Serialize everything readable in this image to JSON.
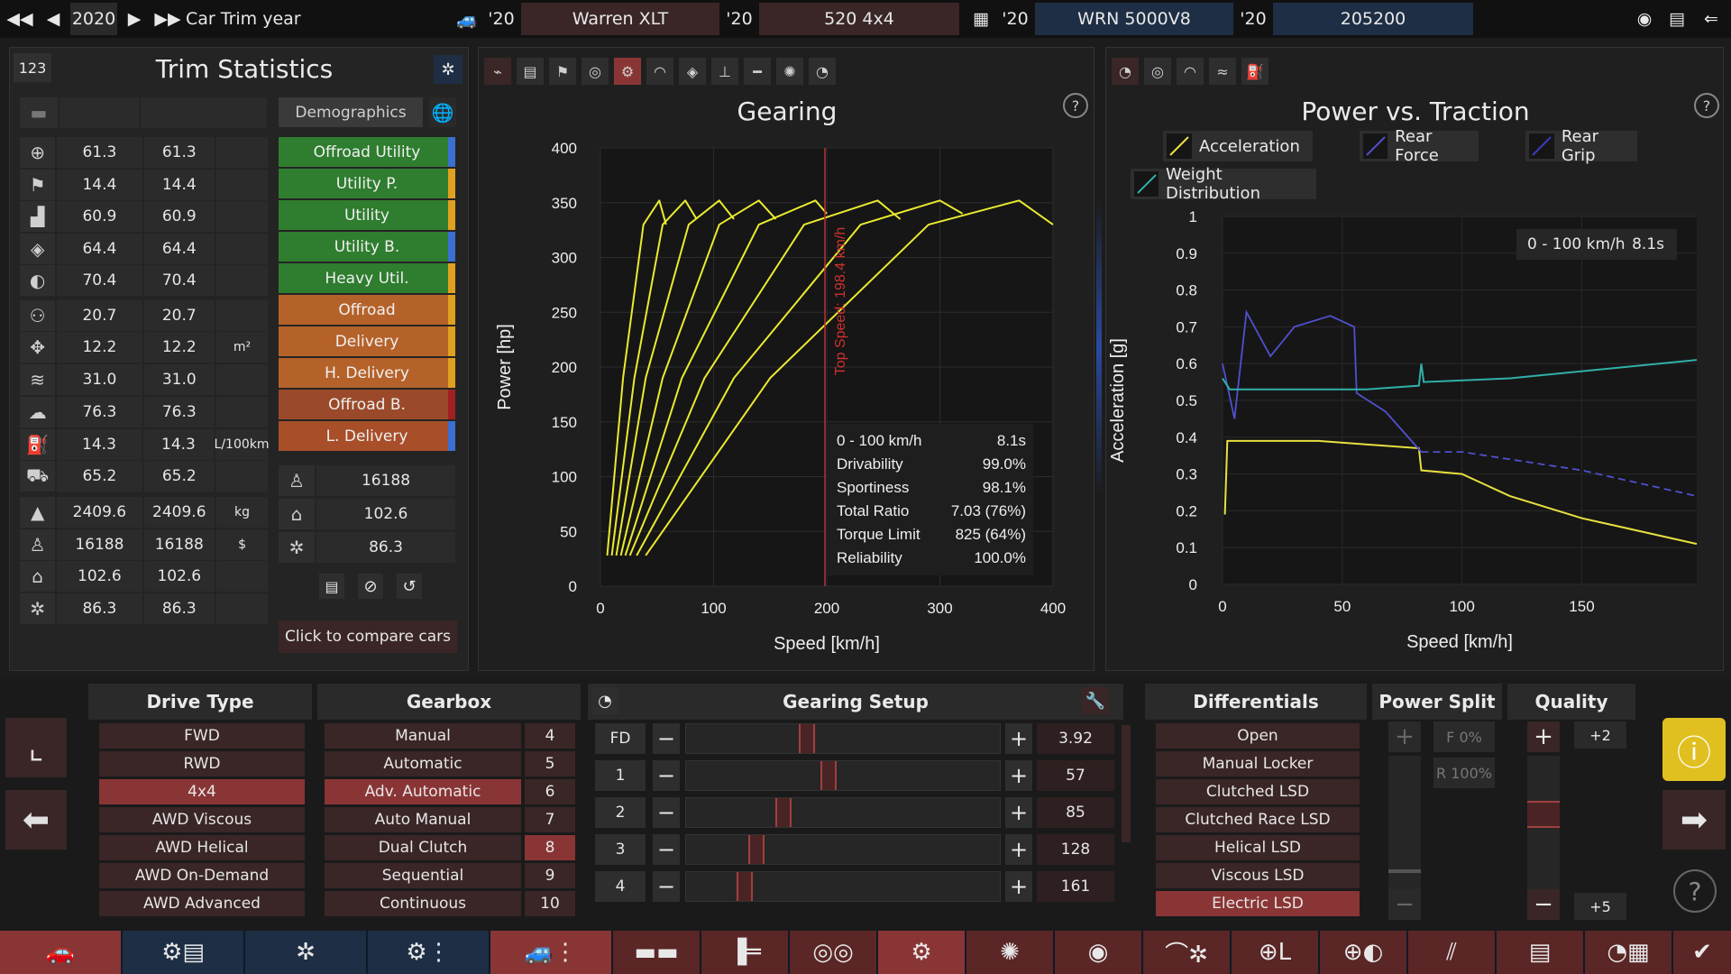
{
  "topbar": {
    "year": "2020",
    "year_label": "Car Trim year",
    "model_year": "'20",
    "model_name": "Warren XLT",
    "trim_year": "'20",
    "trim_name": "520 4x4",
    "engine_year": "'20",
    "engine_name": "WRN 5000V8",
    "variant_year": "'20",
    "variant_name": "205200"
  },
  "stats": {
    "id": "123",
    "title": "Trim Statistics",
    "demographics_label": "Demographics",
    "rows": [
      {
        "icon": "steering-icon",
        "v1": "61.3",
        "v2": "61.3",
        "unit": ""
      },
      {
        "icon": "race-flag-icon",
        "v1": "14.4",
        "v2": "14.4",
        "unit": ""
      },
      {
        "icon": "seat-icon",
        "v1": "60.9",
        "v2": "60.9",
        "unit": ""
      },
      {
        "icon": "shield-icon",
        "v1": "64.4",
        "v2": "64.4",
        "unit": ""
      },
      {
        "icon": "safety-icon",
        "v1": "70.4",
        "v2": "70.4",
        "unit": ""
      },
      {
        "icon": "passengers-icon",
        "v1": "20.7",
        "v2": "20.7",
        "unit": ""
      },
      {
        "icon": "cargo-icon",
        "v1": "12.2",
        "v2": "12.2",
        "unit": "m²"
      },
      {
        "icon": "offroad-icon",
        "v1": "31.0",
        "v2": "31.0",
        "unit": ""
      },
      {
        "icon": "environment-icon",
        "v1": "76.3",
        "v2": "76.3",
        "unit": ""
      },
      {
        "icon": "fuel-icon",
        "v1": "14.3",
        "v2": "14.3",
        "unit": "L/100km"
      },
      {
        "icon": "towing-icon",
        "v1": "65.2",
        "v2": "65.2",
        "unit": ""
      },
      {
        "icon": "weight-icon",
        "v1": "2409.6",
        "v2": "2409.6",
        "unit": "kg"
      },
      {
        "icon": "cost-icon",
        "v1": "16188",
        "v2": "16188",
        "unit": "$"
      },
      {
        "icon": "production-icon",
        "v1": "102.6",
        "v2": "102.6",
        "unit": ""
      },
      {
        "icon": "service-icon",
        "v1": "86.3",
        "v2": "86.3",
        "unit": ""
      }
    ],
    "demographics": [
      {
        "label": "Offroad Utility",
        "color": "#2f7d2f",
        "bar": "#3b6fd1"
      },
      {
        "label": "Utility P.",
        "color": "#2f7d2f",
        "bar": "#e0a020"
      },
      {
        "label": "Utility",
        "color": "#2f7d2f",
        "bar": "#e0a020"
      },
      {
        "label": "Utility B.",
        "color": "#2f7d2f",
        "bar": "#3b6fd1"
      },
      {
        "label": "Heavy Util.",
        "color": "#2f7d2f",
        "bar": "#e0a020"
      },
      {
        "label": "Offroad",
        "color": "#b5622a",
        "bar": "#e0a020"
      },
      {
        "label": "Delivery",
        "color": "#b5622a",
        "bar": "#e0a020"
      },
      {
        "label": "H. Delivery",
        "color": "#b5622a",
        "bar": "#e0a020"
      },
      {
        "label": "Offroad B.",
        "color": "#9a4a2a",
        "bar": "#a02020"
      },
      {
        "label": "L. Delivery",
        "color": "#a84f2a",
        "bar": "#3b6fd1"
      }
    ],
    "summary": [
      {
        "icon": "cost-icon",
        "value": "16188"
      },
      {
        "icon": "production-icon",
        "value": "102.6"
      },
      {
        "icon": "service-icon",
        "value": "86.3"
      }
    ],
    "compare_label": "Click to compare cars"
  },
  "gearing_chart": {
    "title": "Gearing",
    "xlabel": "Speed [km/h]",
    "ylabel": "Power [hp]",
    "xticks": [
      "0",
      "100",
      "200",
      "300",
      "400"
    ],
    "yticks": [
      "0",
      "50",
      "100",
      "150",
      "200",
      "250",
      "300",
      "350",
      "400"
    ],
    "top_speed_label": "Top Speed: 198.4 km/h",
    "stats": [
      {
        "k": "0 - 100 km/h",
        "v": "8.1s"
      },
      {
        "k": "Drivability",
        "v": "99.0%"
      },
      {
        "k": "Sportiness",
        "v": "98.1%"
      },
      {
        "k": "Total Ratio",
        "v": "7.03 (76%)"
      },
      {
        "k": "Torque Limit",
        "v": "825 (64%)"
      },
      {
        "k": "Reliability",
        "v": "100.0%"
      }
    ]
  },
  "traction_chart": {
    "title": "Power vs. Traction",
    "legend": [
      "Acceleration",
      "Rear Force",
      "Rear Grip",
      "Weight Distribution"
    ],
    "xlabel": "Speed [km/h]",
    "ylabel": "Acceleration [g]",
    "xticks": [
      "0",
      "50",
      "100",
      "150"
    ],
    "yticks": [
      "0",
      "0.1",
      "0.2",
      "0.3",
      "0.4",
      "0.5",
      "0.6",
      "0.7",
      "0.8",
      "0.9",
      "1"
    ],
    "badge_label": "0 - 100 km/h",
    "badge_value": "8.1s"
  },
  "chart_data": [
    {
      "type": "line",
      "title": "Gearing",
      "xlabel": "Speed [km/h]",
      "ylabel": "Power [hp]",
      "xlim": [
        0,
        400
      ],
      "ylim": [
        0,
        400
      ],
      "series": [
        {
          "values": [
            [
              6,
              28
            ],
            [
              20,
              190
            ],
            [
              38,
              330
            ],
            [
              52,
              352
            ],
            [
              58,
              330
            ]
          ]
        },
        {
          "values": [
            [
              10,
              28
            ],
            [
              30,
              190
            ],
            [
              55,
              330
            ],
            [
              75,
              352
            ],
            [
              85,
              335
            ]
          ]
        },
        {
          "values": [
            [
              14,
              28
            ],
            [
              40,
              190
            ],
            [
              78,
              330
            ],
            [
              105,
              352
            ],
            [
              118,
              335
            ]
          ]
        },
        {
          "values": [
            [
              18,
              28
            ],
            [
              55,
              190
            ],
            [
              105,
              330
            ],
            [
              140,
              352
            ],
            [
              155,
              335
            ]
          ]
        },
        {
          "values": [
            [
              22,
              28
            ],
            [
              72,
              190
            ],
            [
              140,
              330
            ],
            [
              190,
              352
            ],
            [
              200,
              340
            ]
          ]
        },
        {
          "values": [
            [
              26,
              28
            ],
            [
              92,
              190
            ],
            [
              180,
              330
            ],
            [
              245,
              352
            ],
            [
              265,
              335
            ]
          ]
        },
        {
          "values": [
            [
              32,
              28
            ],
            [
              118,
              190
            ],
            [
              230,
              330
            ],
            [
              300,
              352
            ],
            [
              320,
              340
            ]
          ]
        },
        {
          "values": [
            [
              40,
              28
            ],
            [
              150,
              190
            ],
            [
              290,
              330
            ],
            [
              370,
              352
            ],
            [
              400,
              330
            ]
          ]
        }
      ],
      "annotations": [
        "Top Speed: 198.4 km/h"
      ],
      "top_speed": 198.4
    },
    {
      "type": "line",
      "title": "Power vs. Traction",
      "xlabel": "Speed [km/h]",
      "ylabel": "Acceleration [g]",
      "xlim": [
        0,
        198
      ],
      "ylim": [
        0,
        1
      ],
      "series": [
        {
          "name": "Acceleration",
          "color": "#e8e040",
          "values": [
            [
              1,
              0.19
            ],
            [
              2,
              0.39
            ],
            [
              40,
              0.39
            ],
            [
              82,
              0.37
            ],
            [
              83,
              0.31
            ],
            [
              100,
              0.3
            ],
            [
              120,
              0.24
            ],
            [
              150,
              0.18
            ],
            [
              198,
              0.11
            ]
          ]
        },
        {
          "name": "Rear Force",
          "color": "#5050d0",
          "values": [
            [
              0,
              0.6
            ],
            [
              5,
              0.45
            ],
            [
              10,
              0.74
            ],
            [
              20,
              0.62
            ],
            [
              30,
              0.7
            ],
            [
              45,
              0.73
            ],
            [
              55,
              0.7
            ],
            [
              56,
              0.52
            ],
            [
              68,
              0.47
            ],
            [
              83,
              0.36
            ],
            [
              100,
              0.36
            ],
            [
              150,
              0.31
            ],
            [
              198,
              0.24
            ]
          ]
        },
        {
          "name": "Weight Distribution",
          "color": "#30b0a8",
          "values": [
            [
              0,
              0.56
            ],
            [
              3,
              0.53
            ],
            [
              60,
              0.53
            ],
            [
              82,
              0.54
            ],
            [
              83,
              0.6
            ],
            [
              84,
              0.55
            ],
            [
              120,
              0.56
            ],
            [
              198,
              0.61
            ]
          ]
        }
      ]
    }
  ],
  "bottom": {
    "drive_type_title": "Drive Type",
    "drive_types": [
      "FWD",
      "RWD",
      "4x4",
      "AWD Viscous",
      "AWD Helical",
      "AWD On-Demand",
      "AWD Advanced"
    ],
    "drive_selected": 2,
    "gearbox_title": "Gearbox",
    "gearboxes": [
      "Manual",
      "Automatic",
      "Adv. Automatic",
      "Auto Manual",
      "Dual Clutch",
      "Sequential",
      "Continuous"
    ],
    "gearbox_selected": 2,
    "gear_counts": [
      "4",
      "5",
      "6",
      "7",
      "8",
      "9",
      "10"
    ],
    "gear_count_selected": 4,
    "gearing_title": "Gearing Setup",
    "gears": [
      {
        "label": "FD",
        "value": "3.92",
        "level": 0.38
      },
      {
        "label": "1",
        "value": "57",
        "level": 0.45
      },
      {
        "label": "2",
        "value": "85",
        "level": 0.3
      },
      {
        "label": "3",
        "value": "128",
        "level": 0.21
      },
      {
        "label": "4",
        "value": "161",
        "level": 0.17
      }
    ],
    "diff_title": "Differentials",
    "differentials": [
      "Open",
      "Manual Locker",
      "Clutched LSD",
      "Clutched Race LSD",
      "Helical LSD",
      "Viscous LSD",
      "Electric LSD"
    ],
    "diff_selected": 6,
    "power_split_title": "Power Split",
    "split_front": "F 0%",
    "split_rear": "R 100%",
    "quality_title": "Quality",
    "quality_top": "+2",
    "quality_bottom": "+5"
  }
}
